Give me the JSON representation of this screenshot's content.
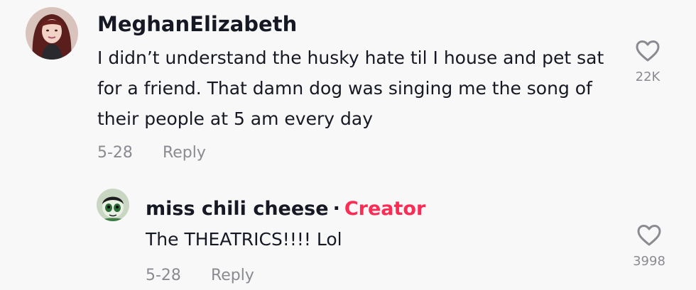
{
  "comments": [
    {
      "username": "MeghanElizabeth",
      "text": "I didn’t understand the husky hate til I house and pet sat for a friend. That damn dog was singing me the song of their people at 5 am every day",
      "date": "5-28",
      "reply_label": "Reply",
      "likes": "22K",
      "avatar_icon": "profile-photo"
    },
    {
      "username": "miss chili cheese",
      "separator": "·",
      "badge": "Creator",
      "text": "The THEATRICS!!!! Lol",
      "date": "5-28",
      "reply_label": "Reply",
      "likes": "3998",
      "avatar_icon": "cartoon-character-avatar"
    }
  ],
  "colors": {
    "background": "#f8f8f8",
    "text": "#161823",
    "muted": "#8a8b91",
    "creator_badge": "#fe2c55"
  }
}
